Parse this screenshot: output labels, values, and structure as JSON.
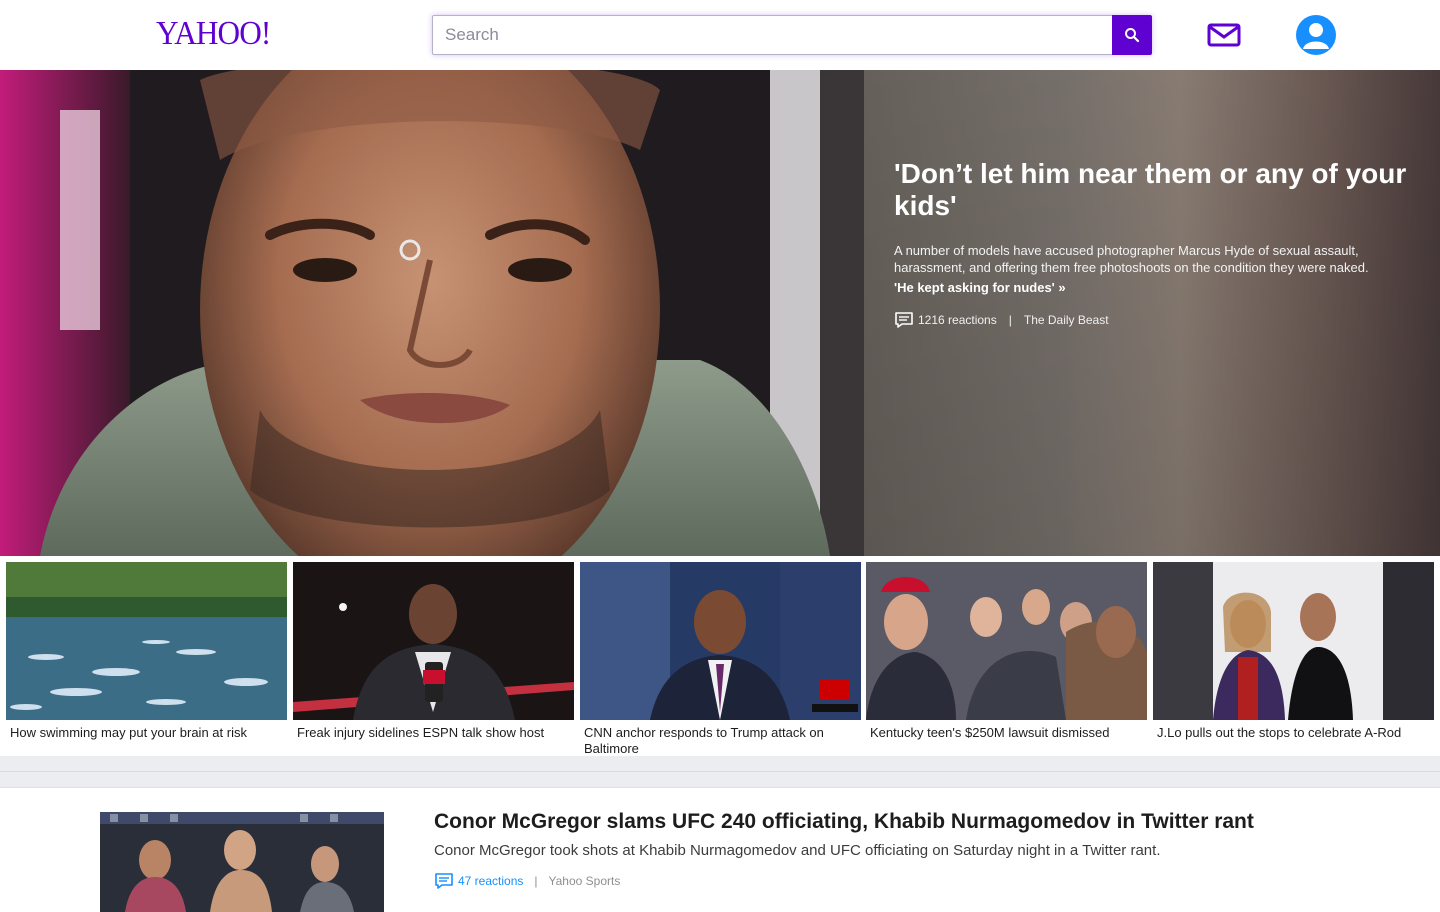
{
  "header": {
    "logo_text": "YAHOO!",
    "search_placeholder": "Search",
    "icons": {
      "search": "search-icon",
      "mail": "mail-icon",
      "account": "user-icon"
    },
    "brand_color": "#5f01d1"
  },
  "hero": {
    "title": "'Don’t let him near them or any of your kids'",
    "description": "A number of models have accused photographer Marcus Hyde of sexual assault, harassment, and offering them free photoshoots on the condition they were naked.",
    "related_link": "'He kept asking for nudes' »",
    "reactions": "1216 reactions",
    "separator": "|",
    "source": "The Daily Beast"
  },
  "thumbnails": [
    {
      "caption": "How swimming may put your brain at risk"
    },
    {
      "caption": "Freak injury sidelines ESPN talk show host"
    },
    {
      "caption": "CNN anchor responds to Trump attack on Baltimore"
    },
    {
      "caption": "Kentucky teen's $250M lawsuit dismissed"
    },
    {
      "caption": "J.Lo pulls out the stops to celebrate A-Rod"
    }
  ],
  "story": {
    "title": "Conor McGregor slams UFC 240 officiating, Khabib Nurmagomedov in Twitter rant",
    "description": "Conor McGregor took shots at Khabib Nurmagomedov and UFC officiating on Saturday night in a Twitter rant.",
    "reactions": "47 reactions",
    "separator": "|",
    "source": "Yahoo Sports"
  }
}
